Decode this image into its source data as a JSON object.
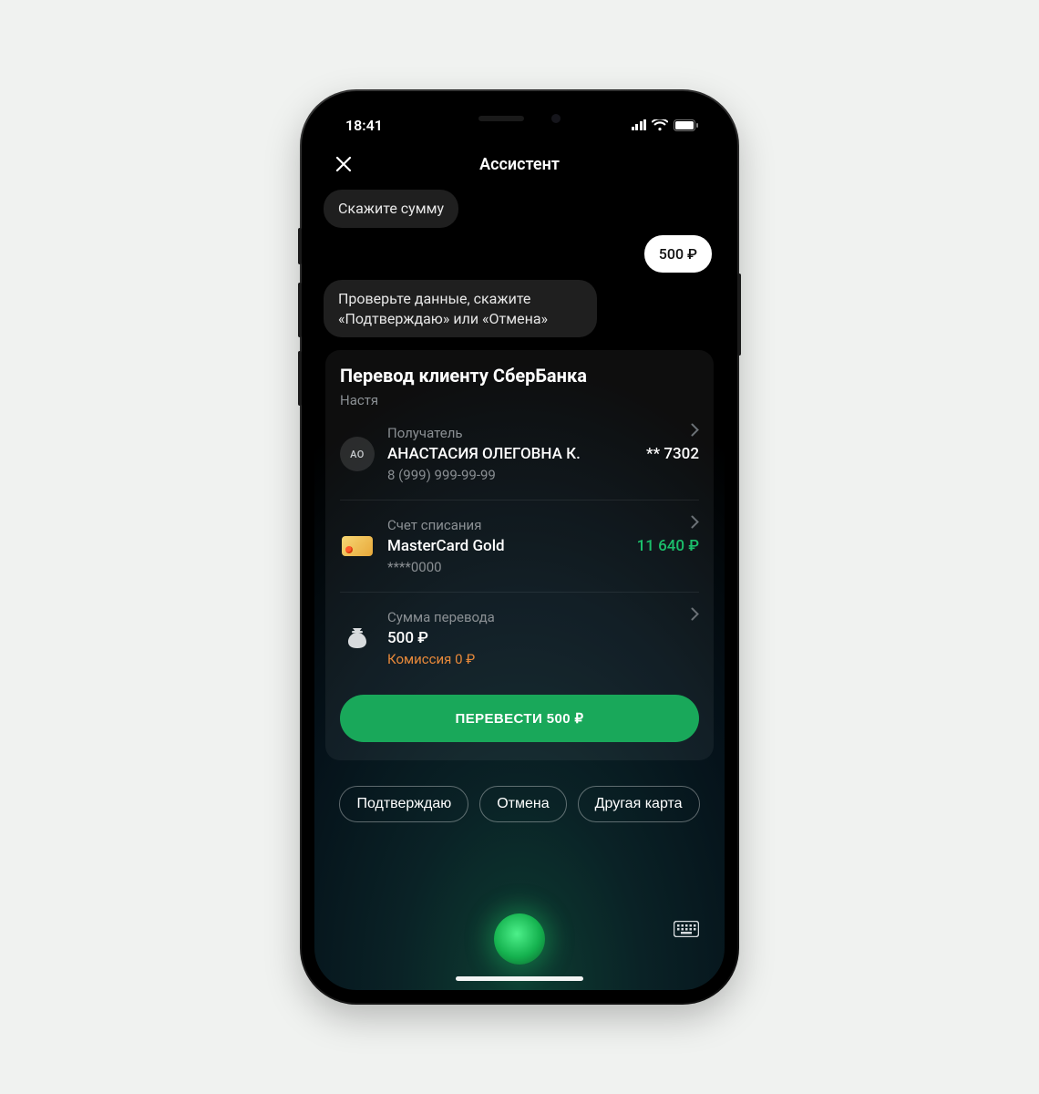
{
  "status": {
    "time": "18:41"
  },
  "header": {
    "title": "Ассистент"
  },
  "chat": {
    "assistant_prompt": "Скажите сумму",
    "user_amount": "500 ₽",
    "assistant_confirm": "Проверьте данные, скажите «Подтверждаю» или «Отмена»"
  },
  "transfer": {
    "title": "Перевод клиенту СберБанка",
    "subtitle": "Настя",
    "recipient": {
      "label": "Получатель",
      "initials": "АО",
      "name": "АНАСТАСИЯ ОЛЕГОВНА К.",
      "phone": "8 (999) 999-99-99",
      "masked": "** 7302"
    },
    "source": {
      "label": "Счет списания",
      "name": "MasterCard Gold",
      "masked": "****0000",
      "balance": "11 640 ₽"
    },
    "amount": {
      "label": "Сумма перевода",
      "value": "500 ₽",
      "fee": "Комиссия 0 ₽"
    },
    "action_label": "ПЕРЕВЕСТИ 500 ₽"
  },
  "voice_chips": {
    "confirm": "Подтверждаю",
    "cancel": "Отмена",
    "other_card": "Другая карта"
  }
}
